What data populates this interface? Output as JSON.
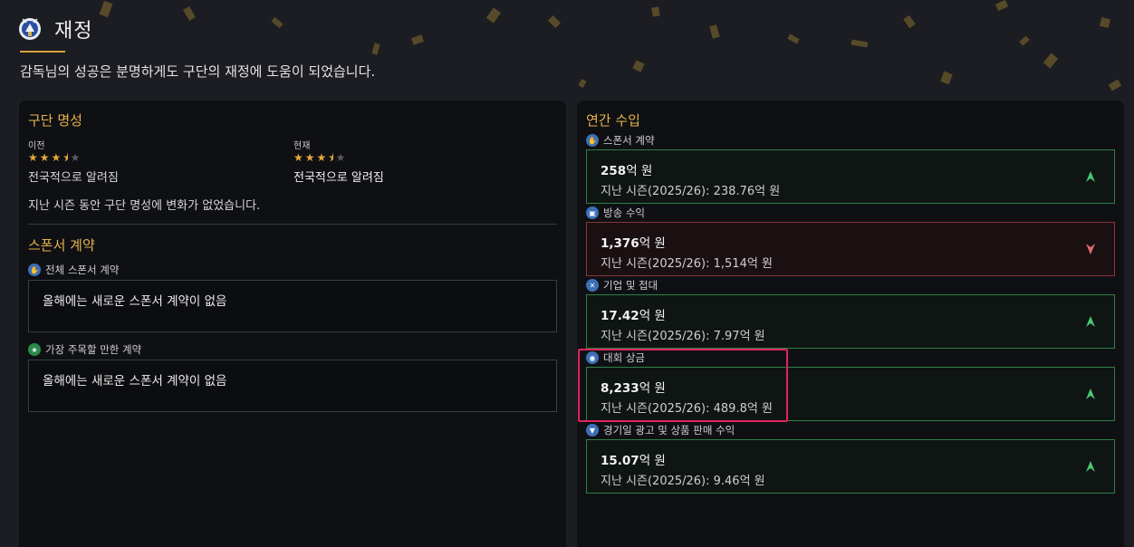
{
  "header": {
    "title": "재정",
    "subtitle": "감독님의 성공은 분명하게도 구단의 재정에 도움이 되었습니다."
  },
  "reputation": {
    "section_title": "구단 명성",
    "previous": {
      "label": "이전",
      "rating": 3.5,
      "max_rating": 5,
      "status": "전국적으로 알려짐"
    },
    "current": {
      "label": "현재",
      "rating": 3.5,
      "max_rating": 5,
      "status": "전국적으로 알려짐"
    },
    "summary": "지난 시즌 동안 구단 명성에 변화가 없었습니다."
  },
  "sponsorship": {
    "section_title": "스폰서 계약",
    "all": {
      "label": "전체 스폰서 계약",
      "message": "올해에는 새로운 스폰서 계약이 없음"
    },
    "notable": {
      "label": "가장 주목할 만한 계약",
      "message": "올해에는 새로운 스폰서 계약이 없음"
    }
  },
  "income": {
    "section_title": "연간 수입",
    "items": [
      {
        "label": "스폰서 계약",
        "amount": "258",
        "unit": "억 원",
        "previous": "지난 시즌(2025/26): 238.76억 원",
        "trend": "up"
      },
      {
        "label": "방송 수익",
        "amount": "1,376",
        "unit": "억 원",
        "previous": "지난 시즌(2025/26): 1,514억 원",
        "trend": "down"
      },
      {
        "label": "기업 및 접대",
        "amount": "17.42",
        "unit": "억 원",
        "previous": "지난 시즌(2025/26): 7.97억 원",
        "trend": "up"
      },
      {
        "label": "대회 상금",
        "amount": "8,233",
        "unit": "억 원",
        "previous": "지난 시즌(2025/26): 489.8억 원",
        "trend": "up"
      },
      {
        "label": "경기일 광고 및 상품 판매 수익",
        "amount": "15.07",
        "unit": "억 원",
        "previous": "지난 시즌(2025/26): 9.46억 원",
        "trend": "up"
      }
    ]
  },
  "colors": {
    "accent": "#e6b24a",
    "up_border": "#2f7f45",
    "down_border": "#8a3538",
    "highlight": "#e0245e"
  }
}
